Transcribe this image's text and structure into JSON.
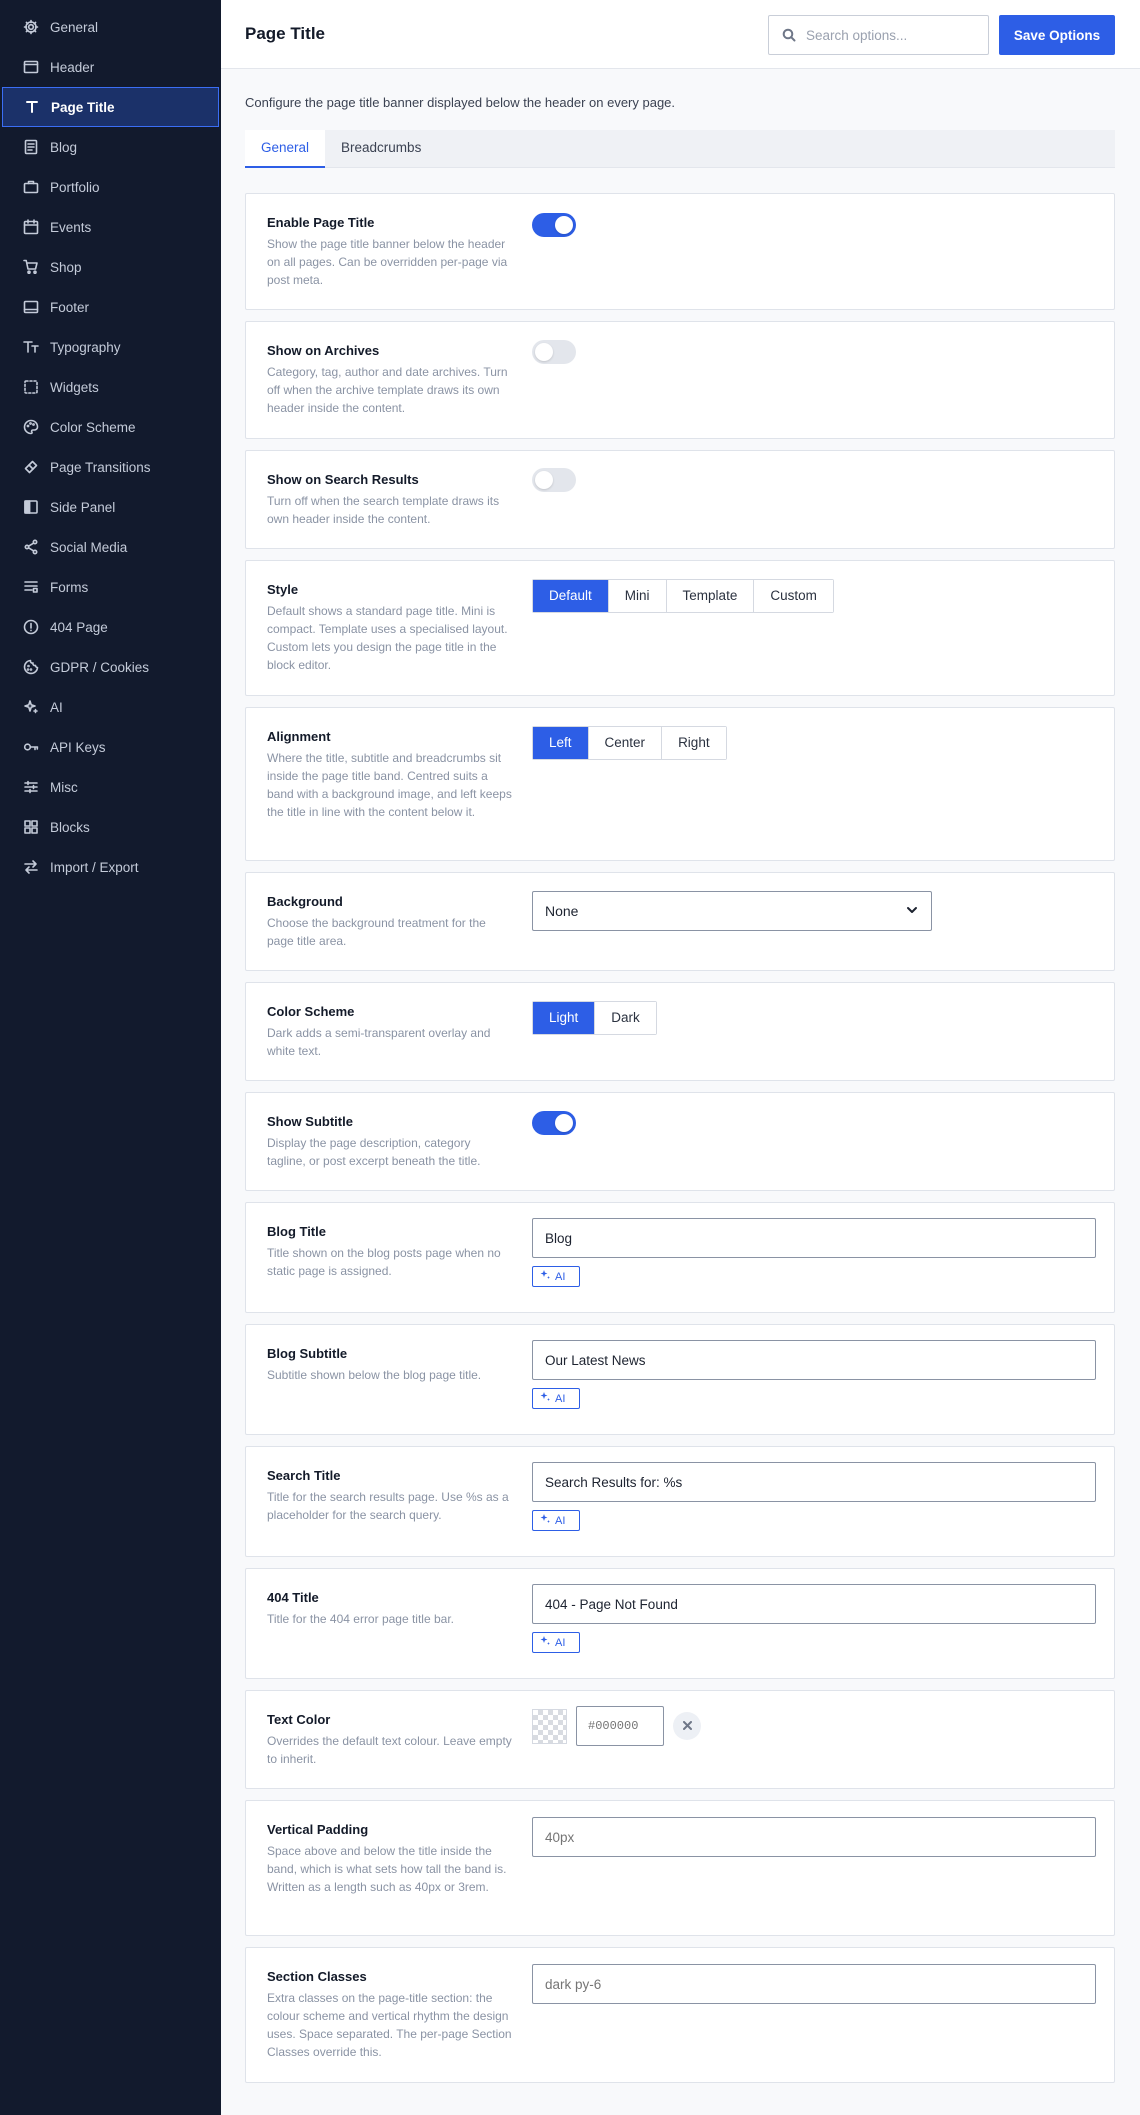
{
  "colors": {
    "accent": "#2d5ee6",
    "sidebar_bg": "#121a2d",
    "sidebar_active_bg": "#1b3169"
  },
  "sidebar": {
    "items": [
      {
        "label": "General",
        "icon": "gear-icon"
      },
      {
        "label": "Header",
        "icon": "window-icon"
      },
      {
        "label": "Page Title",
        "icon": "text-t-icon",
        "active": true
      },
      {
        "label": "Blog",
        "icon": "document-icon"
      },
      {
        "label": "Portfolio",
        "icon": "briefcase-icon"
      },
      {
        "label": "Events",
        "icon": "calendar-icon"
      },
      {
        "label": "Shop",
        "icon": "cart-icon"
      },
      {
        "label": "Footer",
        "icon": "footer-layout-icon"
      },
      {
        "label": "Typography",
        "icon": "typography-icon"
      },
      {
        "label": "Widgets",
        "icon": "widgets-dashed-icon"
      },
      {
        "label": "Color Scheme",
        "icon": "palette-icon"
      },
      {
        "label": "Page Transitions",
        "icon": "transition-icon"
      },
      {
        "label": "Side Panel",
        "icon": "side-panel-icon"
      },
      {
        "label": "Social Media",
        "icon": "share-icon"
      },
      {
        "label": "Forms",
        "icon": "forms-icon"
      },
      {
        "label": "404 Page",
        "icon": "alert-circle-icon"
      },
      {
        "label": "GDPR / Cookies",
        "icon": "cookie-icon"
      },
      {
        "label": "AI",
        "icon": "sparkle-icon"
      },
      {
        "label": "API Keys",
        "icon": "key-icon"
      },
      {
        "label": "Misc",
        "icon": "sliders-icon"
      },
      {
        "label": "Blocks",
        "icon": "blocks-grid-icon"
      },
      {
        "label": "Import / Export",
        "icon": "swap-arrows-icon"
      }
    ]
  },
  "header": {
    "title": "Page Title",
    "search_placeholder": "Search options...",
    "save_label": "Save Options"
  },
  "main": {
    "intro": "Configure the page title banner displayed below the header on every page.",
    "tabs": [
      {
        "label": "General",
        "active": true
      },
      {
        "label": "Breadcrumbs",
        "active": false
      }
    ]
  },
  "settings": {
    "enable_page_title": {
      "title": "Enable Page Title",
      "description": "Show the page title banner below the header on all pages. Can be overridden per-page via post meta.",
      "enabled": true
    },
    "show_on_archives": {
      "title": "Show on Archives",
      "description": "Category, tag, author and date archives. Turn off when the archive template draws its own header inside the content.",
      "enabled": false
    },
    "show_on_search": {
      "title": "Show on Search Results",
      "description": "Turn off when the search template draws its own header inside the content.",
      "enabled": false
    },
    "style": {
      "title": "Style",
      "description": "Default shows a standard page title. Mini is compact. Template uses a specialised layout. Custom lets you design the page title in the block editor.",
      "options": [
        "Default",
        "Mini",
        "Template",
        "Custom"
      ],
      "selected": "Default"
    },
    "alignment": {
      "title": "Alignment",
      "description": "Where the title, subtitle and breadcrumbs sit inside the page title band. Centred suits a band with a background image, and left keeps the title in line with the content below it.",
      "options": [
        "Left",
        "Center",
        "Right"
      ],
      "selected": "Left"
    },
    "background": {
      "title": "Background",
      "description": "Choose the background treatment for the page title area.",
      "value": "None"
    },
    "color_scheme": {
      "title": "Color Scheme",
      "description": "Dark adds a semi-transparent overlay and white text.",
      "options": [
        "Light",
        "Dark"
      ],
      "selected": "Light"
    },
    "show_subtitle": {
      "title": "Show Subtitle",
      "description": "Display the page description, category tagline, or post excerpt beneath the title.",
      "enabled": true
    },
    "blog_title": {
      "title": "Blog Title",
      "description": "Title shown on the blog posts page when no static page is assigned.",
      "value": "Blog",
      "ai_label": "AI"
    },
    "blog_subtitle": {
      "title": "Blog Subtitle",
      "description": "Subtitle shown below the blog page title.",
      "value": "Our Latest News",
      "ai_label": "AI"
    },
    "search_title": {
      "title": "Search Title",
      "description": "Title for the search results page. Use %s as a placeholder for the search query.",
      "value": "Search Results for: %s",
      "ai_label": "AI"
    },
    "title_404": {
      "title": "404 Title",
      "description": "Title for the 404 error page title bar.",
      "value": "404 - Page Not Found",
      "ai_label": "AI"
    },
    "text_color": {
      "title": "Text Color",
      "description": "Overrides the default text colour. Leave empty to inherit.",
      "placeholder": "#000000"
    },
    "vertical_padding": {
      "title": "Vertical Padding",
      "description": "Space above and below the title inside the band, which is what sets how tall the band is. Written as a length such as 40px or 3rem.",
      "placeholder": "40px"
    },
    "section_classes": {
      "title": "Section Classes",
      "description": "Extra classes on the page-title section: the colour scheme and vertical rhythm the design uses. Space separated. The per-page Section Classes override this.",
      "placeholder": "dark py-6"
    }
  }
}
